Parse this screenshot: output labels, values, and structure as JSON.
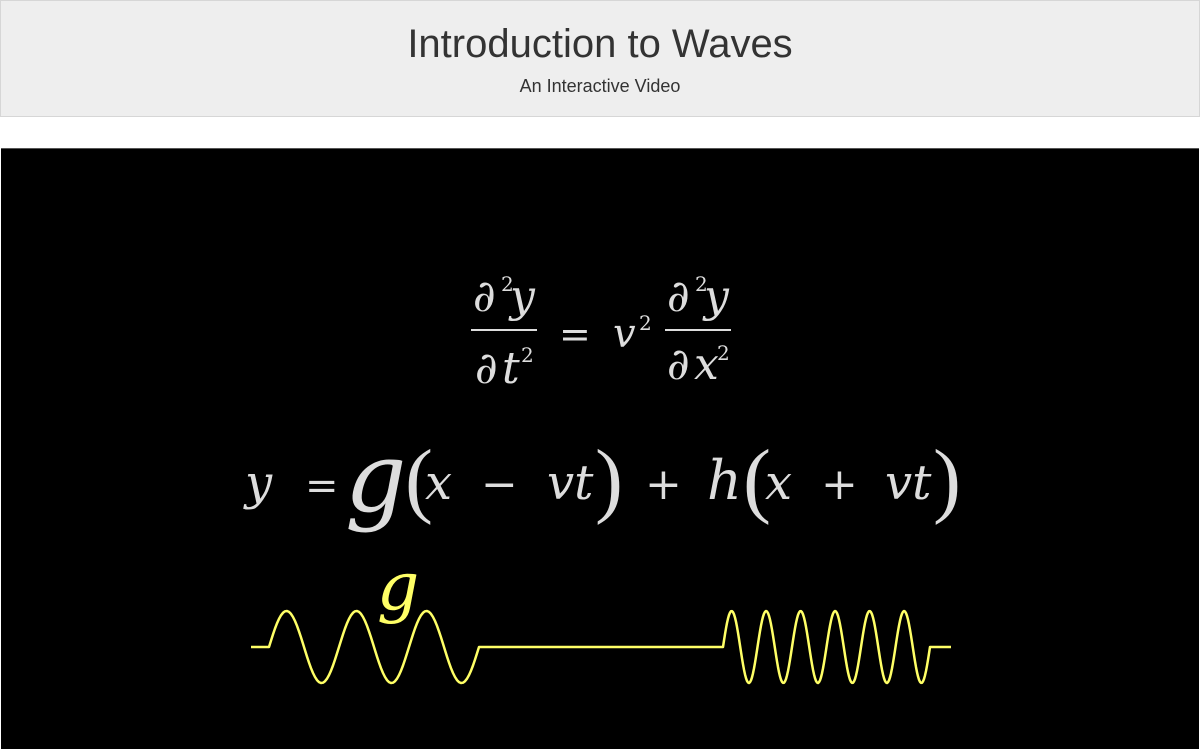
{
  "header": {
    "title": "Introduction to Waves",
    "subtitle": "An Interactive Video"
  },
  "video": {
    "wave_equation": {
      "partial": "∂",
      "y": "y",
      "t": "t",
      "x": "x",
      "v": "v",
      "exp": "2",
      "equals": "="
    },
    "general_solution": {
      "y": "y",
      "equals": "=",
      "g": "g",
      "h": "h",
      "open_paren": "(",
      "close_paren": ")",
      "x": "x",
      "minus": "−",
      "plus": "+",
      "vt": "vt"
    },
    "wave_label": "g",
    "colors": {
      "background": "#000000",
      "equation_text": "#dddddd",
      "wave": "#ffff66"
    }
  }
}
